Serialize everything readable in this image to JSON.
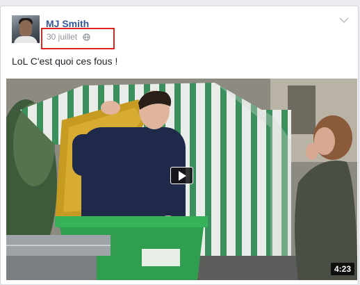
{
  "post": {
    "author": "MJ Smith",
    "date": "30 juillet",
    "privacy_icon": "globe-icon",
    "menu_icon": "chevron-down-icon",
    "text": "LoL C'est quoi ces fous !",
    "video": {
      "duration": "4:23",
      "play_icon": "play-icon"
    }
  },
  "colors": {
    "link": "#365899",
    "meta": "#90949c",
    "highlight": "#e0231f",
    "bin": "#2f9e4f"
  }
}
